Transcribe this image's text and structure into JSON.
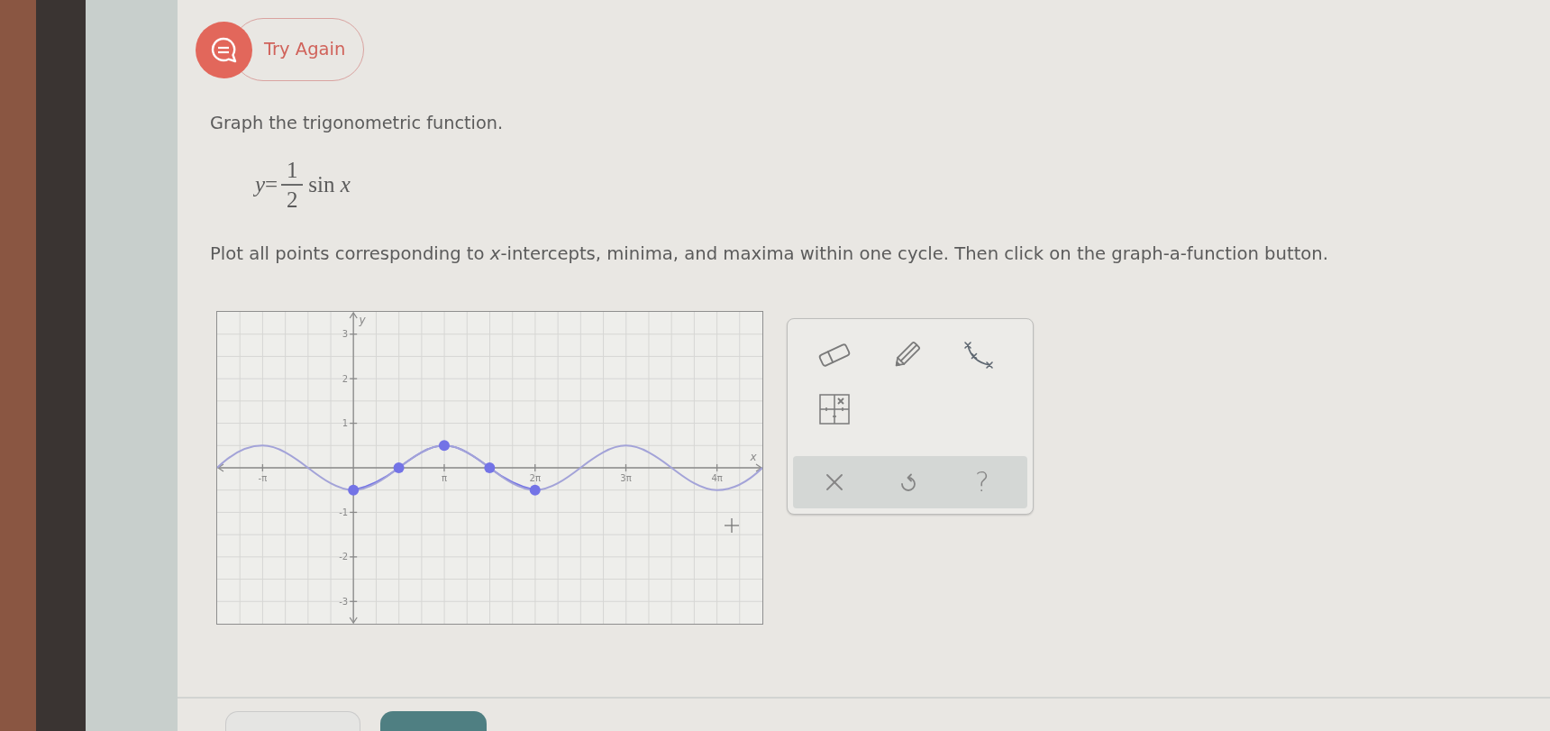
{
  "feedback": {
    "label": "Try Again"
  },
  "question": {
    "instruction": "Graph the trigonometric function.",
    "equation": {
      "lhs": "*y*=",
      "numerator": "1",
      "denominator": "2",
      "rhs": "sin *x*"
    },
    "task": "Plot all points corresponding to *x*-intercepts, minima, and maxima within one cycle. Then click on the graph-a-function button."
  },
  "graph": {
    "chart_data": {
      "type": "line",
      "xlabel": "x",
      "ylabel": "y",
      "x": [
        -4.71,
        -3.14,
        -1.57,
        0,
        1.57,
        3.14,
        4.71,
        6.28,
        7.85,
        9.42,
        11,
        12.57,
        14.14
      ],
      "series": [
        {
          "color": "#a3a3d8",
          "values": [
            0,
            0.5,
            0,
            -0.5,
            0,
            0.5,
            0,
            -0.5,
            0,
            0.5,
            0,
            -0.5,
            0
          ]
        },
        {
          "color": "#7373e6",
          "marker": "circle",
          "values": [
            null,
            null,
            null,
            -0.5,
            0,
            0.5,
            0,
            -0.5,
            null,
            null,
            null,
            null,
            null
          ]
        }
      ],
      "xlim": [
        -4.71,
        14.14
      ],
      "ylim": [
        -3.5,
        3.5
      ],
      "xticks": [
        {
          "value": -3.14,
          "label": "-π"
        },
        {
          "value": 3.14,
          "label": "π"
        },
        {
          "value": 6.28,
          "label": "2π"
        },
        {
          "value": 9.42,
          "label": "3π"
        },
        {
          "value": 12.57,
          "label": "4π"
        }
      ],
      "yticks": [
        -3,
        -2,
        -1,
        1,
        2,
        3
      ],
      "grid": true
    }
  },
  "tool_panel": {
    "help_label": "?"
  }
}
